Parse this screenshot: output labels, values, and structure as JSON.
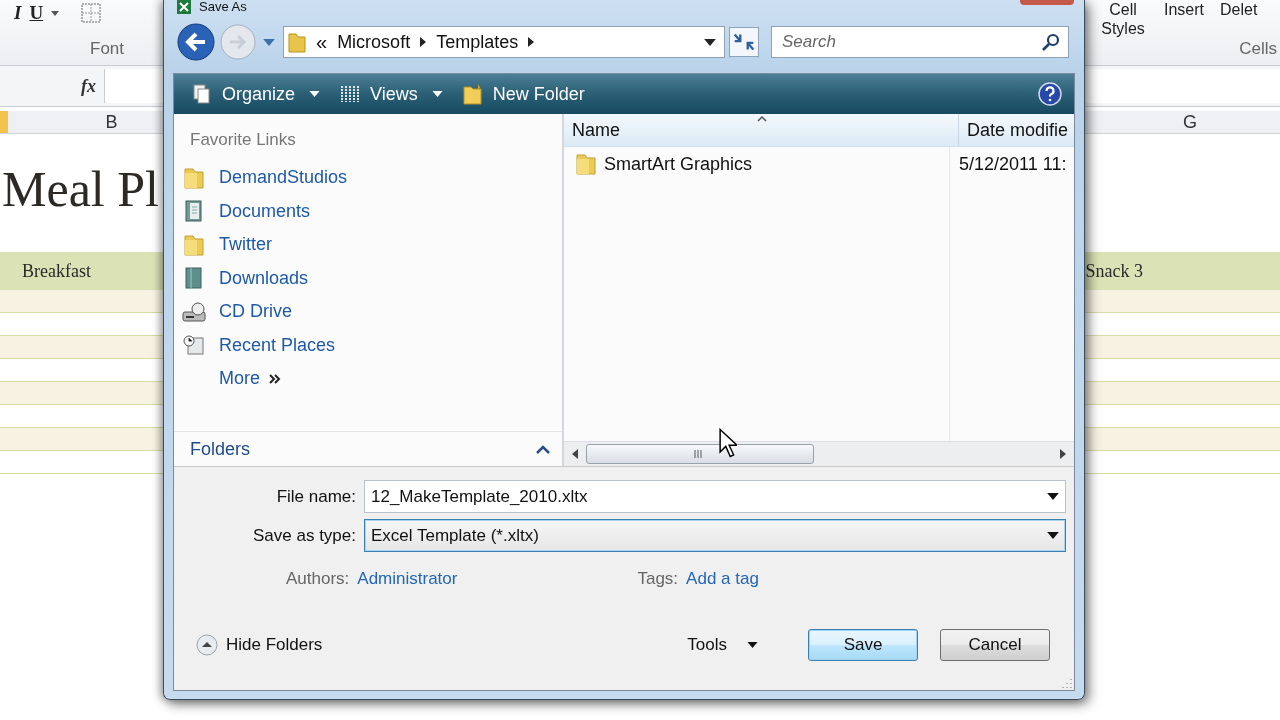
{
  "excel": {
    "ribbon": {
      "font_tools": [
        "I",
        "U"
      ],
      "font_label": "Font",
      "cell_styles": "Cell Styles",
      "insert": "Insert",
      "delete": "Delet",
      "cells_label": "Cells"
    },
    "formula_bar": {
      "function_label": "fx"
    },
    "columns": [
      "B",
      "G"
    ],
    "sheet_title": "Meal Pl",
    "table_headers": [
      "Breakfast",
      "Snack 3"
    ]
  },
  "dialog": {
    "title": "Save As",
    "breadcrumb_overflow": "«",
    "breadcrumb": [
      "Microsoft",
      "Templates"
    ],
    "search": {
      "placeholder": "Search"
    },
    "toolbar": [
      {
        "label": "Organize",
        "kind": "organize"
      },
      {
        "label": "Views",
        "kind": "views"
      },
      {
        "label": "New Folder",
        "kind": "new-folder"
      }
    ],
    "favorite_links": {
      "heading": "Favorite Links",
      "items": [
        {
          "label": "DemandStudios",
          "kind": "folder"
        },
        {
          "label": "Documents",
          "kind": "documents"
        },
        {
          "label": "Twitter",
          "kind": "folder"
        },
        {
          "label": "Downloads",
          "kind": "downloads"
        },
        {
          "label": "CD Drive",
          "kind": "drive"
        },
        {
          "label": "Recent Places",
          "kind": "recent"
        },
        {
          "label": "More",
          "kind": "more"
        }
      ]
    },
    "folders_label": "Folders",
    "file_list": {
      "columns": [
        "Name",
        "Date modifie"
      ],
      "rows": [
        {
          "name": "SmartArt Graphics",
          "date": "5/12/2011 11:"
        }
      ]
    },
    "fields": [
      {
        "label": "File name:",
        "value": "12_MakeTemplate_2010.xltx",
        "focused": false
      },
      {
        "label": "Save as type:",
        "value": "Excel Template (*.xltx)",
        "focused": true
      }
    ],
    "metadata": [
      {
        "label": "Authors:",
        "value": "Administrator"
      },
      {
        "label": "Tags:",
        "value": "Add a tag"
      }
    ],
    "hide_folders": "Hide Folders",
    "tools": "Tools",
    "buttons": [
      {
        "label": "Save",
        "default": true
      },
      {
        "label": "Cancel",
        "default": false
      }
    ]
  }
}
